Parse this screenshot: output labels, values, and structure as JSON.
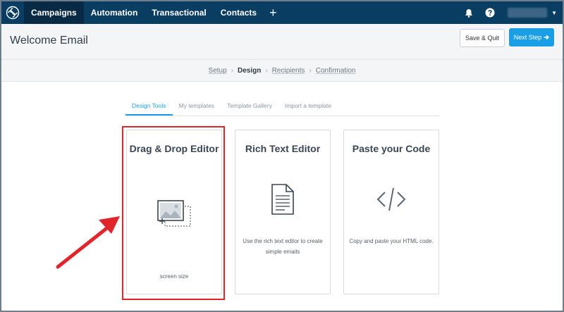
{
  "nav": {
    "items": [
      "Campaigns",
      "Automation",
      "Transactional",
      "Contacts"
    ],
    "plus": "+"
  },
  "header": {
    "title": "Welcome Email",
    "save_label": "Save & Quit",
    "next_label": "Next Step"
  },
  "steps": [
    "Setup",
    "Design",
    "Recipients",
    "Confirmation"
  ],
  "tabs": [
    "Design Tools",
    "My templates",
    "Template Gallery",
    "Import a template"
  ],
  "cards": {
    "dnd": {
      "title": "Drag & Drop Editor",
      "desc": "screen size"
    },
    "rte": {
      "title": "Rich Text Editor",
      "desc": "Use the rich text editor to create simple emails"
    },
    "code": {
      "title": "Paste your Code",
      "desc": "Copy and paste your HTML code."
    }
  },
  "colors": {
    "nav_bg": "#0a3d62",
    "accent": "#1a9fe6",
    "annotation": "#e0252b"
  }
}
